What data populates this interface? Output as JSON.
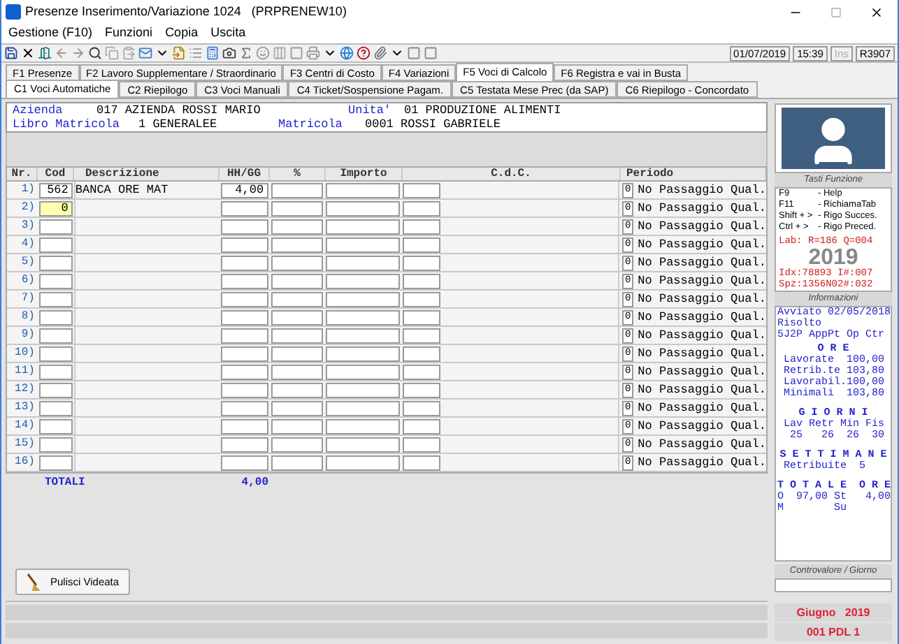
{
  "window": {
    "title": "Presenze Inserimento/Variazione 1024   (PRPRENEW10)"
  },
  "menu": [
    "Gestione (F10)",
    "Funzioni",
    "Copia",
    "Uscita"
  ],
  "status": {
    "date": "01/07/2019",
    "time": "15:39",
    "ins": "Ins",
    "ins_disabled": true,
    "code": "R3907"
  },
  "function_tabs": [
    {
      "label": "F1 Presenze",
      "selected": false
    },
    {
      "label": "F2 Lavoro Supplementare / Straordinario",
      "selected": false
    },
    {
      "label": "F3 Centri di Costo",
      "selected": false
    },
    {
      "label": "F4 Variazioni",
      "selected": false
    },
    {
      "label": "F5 Voci di Calcolo",
      "selected": true
    },
    {
      "label": "F6 Registra e vai in Busta",
      "selected": false
    }
  ],
  "sub_tabs": [
    {
      "label": "C1 Voci Automatiche",
      "selected": true
    },
    {
      "label": "C2 Riepilogo",
      "selected": false
    },
    {
      "label": "C3 Voci Manuali",
      "selected": false
    },
    {
      "label": "C4 Ticket/Sospensione Pagam.",
      "selected": false
    },
    {
      "label": "C5 Testata Mese Prec (da SAP)",
      "selected": false
    },
    {
      "label": "C6 Riepilogo - Concordato",
      "selected": false
    }
  ],
  "header": {
    "azienda_label": "Azienda",
    "azienda": "017 AZIENDA ROSSI MARIO",
    "unita_label": "Unita'",
    "unita": "01 PRODUZIONE ALIMENTI",
    "libro_label": "Libro Matricola",
    "libro": "1 GENERALEE",
    "matricola_label": "Matricola",
    "matricola": "0001 ROSSI GABRIELE"
  },
  "table": {
    "columns": [
      "Nr.",
      "Cod",
      "Descrizione",
      "HH/GG",
      "%",
      "Importo",
      "C.d.C.",
      "Periodo"
    ],
    "rows": [
      {
        "nr": "1)",
        "cod": "562",
        "descrizione": "BANCA ORE MAT",
        "hh_gg": "4,00",
        "periodo": "0",
        "periodo_label": "No Passaggio Qual.",
        "focused": false
      },
      {
        "nr": "2)",
        "cod": "0",
        "periodo": "0",
        "periodo_label": "No Passaggio Qual.",
        "focused": true
      },
      {
        "nr": "3)",
        "periodo": "0",
        "periodo_label": "No Passaggio Qual.",
        "focused": false
      },
      {
        "nr": "4)",
        "periodo": "0",
        "periodo_label": "No Passaggio Qual.",
        "focused": false
      },
      {
        "nr": "5)",
        "periodo": "0",
        "periodo_label": "No Passaggio Qual.",
        "focused": false
      },
      {
        "nr": "6)",
        "periodo": "0",
        "periodo_label": "No Passaggio Qual.",
        "focused": false
      },
      {
        "nr": "7)",
        "periodo": "0",
        "periodo_label": "No Passaggio Qual.",
        "focused": false
      },
      {
        "nr": "8)",
        "periodo": "0",
        "periodo_label": "No Passaggio Qual.",
        "focused": false
      },
      {
        "nr": "9)",
        "periodo": "0",
        "periodo_label": "No Passaggio Qual.",
        "focused": false
      },
      {
        "nr": "10)",
        "periodo": "0",
        "periodo_label": "No Passaggio Qual.",
        "focused": false
      },
      {
        "nr": "11)",
        "periodo": "0",
        "periodo_label": "No Passaggio Qual.",
        "focused": false
      },
      {
        "nr": "12)",
        "periodo": "0",
        "periodo_label": "No Passaggio Qual.",
        "focused": false
      },
      {
        "nr": "13)",
        "periodo": "0",
        "periodo_label": "No Passaggio Qual.",
        "focused": false
      },
      {
        "nr": "14)",
        "periodo": "0",
        "periodo_label": "No Passaggio Qual.",
        "focused": false
      },
      {
        "nr": "15)",
        "periodo": "0",
        "periodo_label": "No Passaggio Qual.",
        "focused": false
      },
      {
        "nr": "16)",
        "periodo": "0",
        "periodo_label": "No Passaggio Qual.",
        "focused": false
      }
    ],
    "totals_label": "TOTALI",
    "totals_hh_gg": "4,00"
  },
  "clear_button": "Pulisci Videata",
  "side_panel": {
    "caption": "Tasti Funzione",
    "keys": [
      {
        "key": "F9",
        "action": "- Help"
      },
      {
        "key": "F11",
        "action": "- RichiamaTab"
      },
      {
        "key": "Shift + >",
        "action": "- Rigo Succes."
      },
      {
        "key": "Ctrl + >",
        "action": "- Rigo Preced."
      }
    ],
    "lab": "Lab: R=186 Q=004",
    "year": "2019",
    "idx": "Idx:78893 I#:007",
    "spz": "Spz:1356N02#:032",
    "info_caption": "Informazioni",
    "info": [
      {
        "kind": "line",
        "text": "Avviato 02/05/2018"
      },
      {
        "kind": "line",
        "text": "Risolto"
      },
      {
        "kind": "line",
        "text": "5J2P AppPt Op Ctr"
      },
      {
        "kind": "heading",
        "text": "O R E"
      },
      {
        "kind": "line",
        "text": " Lavorate  100,00"
      },
      {
        "kind": "line",
        "text": " Retrib.te 103,80"
      },
      {
        "kind": "line",
        "text": " Lavorabil.100,00"
      },
      {
        "kind": "line",
        "text": " Minimali  103,80"
      },
      {
        "kind": "gap"
      },
      {
        "kind": "heading",
        "text": "G I O R N I"
      },
      {
        "kind": "line",
        "text": " Lav Retr Min Fis"
      },
      {
        "kind": "line",
        "text": "  25   26  26  30"
      },
      {
        "kind": "gap"
      },
      {
        "kind": "heading",
        "text": "S E T T I M A N E"
      },
      {
        "kind": "line",
        "text": " Retribuite  5"
      },
      {
        "kind": "gap"
      },
      {
        "kind": "heading",
        "text": "T O T A L E  O R E"
      },
      {
        "kind": "line",
        "text": "O  97,00 St   4,00"
      },
      {
        "kind": "line",
        "text": "M        Su"
      }
    ],
    "value_caption": "Controvalore / Giorno",
    "period": "Giugno   2019",
    "unit": "001 PDL 1"
  }
}
